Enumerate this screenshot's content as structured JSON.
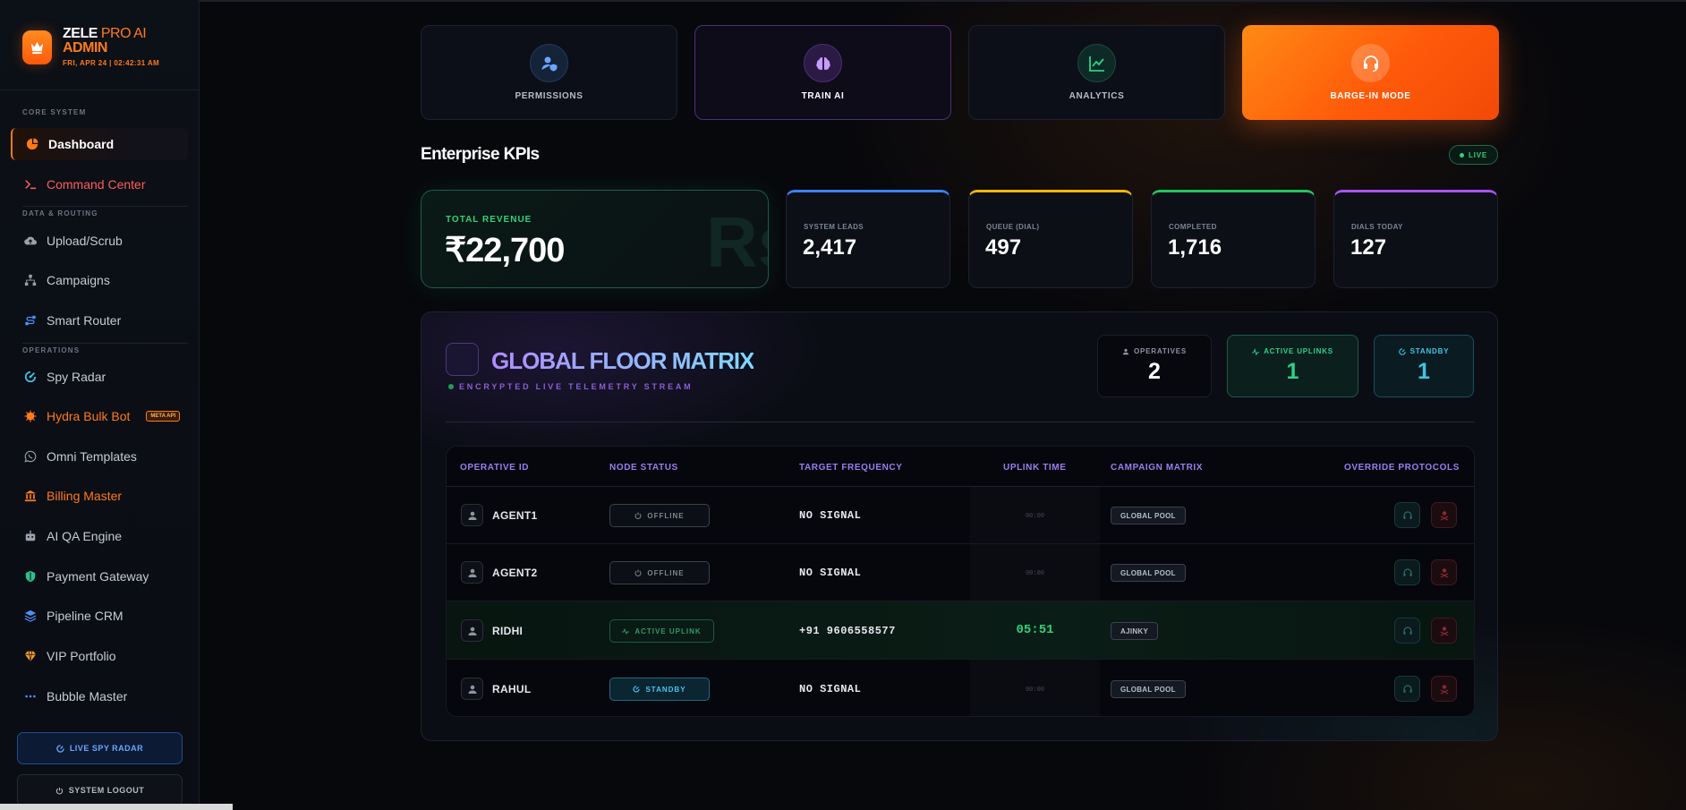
{
  "brand": {
    "name_bold": "ZELE",
    "name_light": "PRO AI",
    "name_second": "ADMIN",
    "datetime": "FRI, APR 24 | 02:42:31 AM",
    "logo_icon": "crown-icon"
  },
  "sidebar": {
    "sections": {
      "core": "CORE SYSTEM",
      "data": "DATA & ROUTING",
      "ops": "OPERATIONS"
    },
    "items": [
      {
        "label": "Dashboard",
        "icon": "pie-chart-icon"
      },
      {
        "label": "Command Center",
        "icon": "terminal-icon"
      },
      {
        "label": "Upload/Scrub",
        "icon": "cloud-upload-icon"
      },
      {
        "label": "Campaigns",
        "icon": "sitemap-icon"
      },
      {
        "label": "Smart Router",
        "icon": "route-icon"
      },
      {
        "label": "Spy Radar",
        "icon": "radar-icon"
      },
      {
        "label": "Hydra Bulk Bot",
        "icon": "virus-icon",
        "badge": "META API"
      },
      {
        "label": "Omni Templates",
        "icon": "whatsapp-icon"
      },
      {
        "label": "Billing Master",
        "icon": "bank-icon"
      },
      {
        "label": "AI QA Engine",
        "icon": "robot-icon"
      },
      {
        "label": "Payment Gateway",
        "icon": "shield-icon"
      },
      {
        "label": "Pipeline CRM",
        "icon": "layers-icon"
      },
      {
        "label": "VIP Portfolio",
        "icon": "gem-icon"
      },
      {
        "label": "Bubble Master",
        "icon": "dots-icon"
      }
    ],
    "live_spy_button": "LIVE SPY RADAR",
    "logout_button": "SYSTEM LOGOUT"
  },
  "quick_actions": [
    {
      "label": "PERMISSIONS",
      "icon": "user-shield-icon"
    },
    {
      "label": "TRAIN AI",
      "icon": "brain-icon"
    },
    {
      "label": "ANALYTICS",
      "icon": "line-chart-icon"
    },
    {
      "label": "BARGE-IN MODE",
      "icon": "headset-icon",
      "color": "#ff6a10"
    }
  ],
  "kpis": {
    "title": "Enterprise KPIs",
    "live": "LIVE",
    "revenue": {
      "label": "TOTAL REVENUE",
      "value": "₹22,700",
      "watermark": "Rs"
    },
    "stats": [
      {
        "label": "SYSTEM LEADS",
        "value": "2,417",
        "color": "#3b82f6"
      },
      {
        "label": "QUEUE (DIAL)",
        "value": "497",
        "color": "#f5b70b"
      },
      {
        "label": "COMPLETED",
        "value": "1,716",
        "color": "#22c55e"
      },
      {
        "label": "DIALS TODAY",
        "value": "127",
        "color": "#a855f7"
      }
    ]
  },
  "matrix": {
    "title": "GLOBAL FLOOR MATRIX",
    "subtitle": "ENCRYPTED LIVE TELEMETRY STREAM",
    "counters": [
      {
        "label": "OPERATIVES",
        "value": "2"
      },
      {
        "label": "ACTIVE UPLINKS",
        "value": "1"
      },
      {
        "label": "STANDBY",
        "value": "1"
      }
    ],
    "columns": [
      "OPERATIVE ID",
      "NODE STATUS",
      "TARGET FREQUENCY",
      "UPLINK TIME",
      "CAMPAIGN MATRIX",
      "OVERRIDE PROTOCOLS"
    ],
    "rows": [
      {
        "id": "AGENT1",
        "status": "OFFLINE",
        "freq": "NO SIGNAL",
        "time": "00:00",
        "campaign": "GLOBAL POOL"
      },
      {
        "id": "AGENT2",
        "status": "OFFLINE",
        "freq": "NO SIGNAL",
        "time": "00:00",
        "campaign": "GLOBAL POOL"
      },
      {
        "id": "RIDHI",
        "status": "ACTIVE UPLINK",
        "freq": "+91 9606558577",
        "time": "05:51",
        "campaign": "AJINKY"
      },
      {
        "id": "RAHUL",
        "status": "STANDBY",
        "freq": "NO SIGNAL",
        "time": "00:00",
        "campaign": "GLOBAL POOL"
      }
    ]
  }
}
